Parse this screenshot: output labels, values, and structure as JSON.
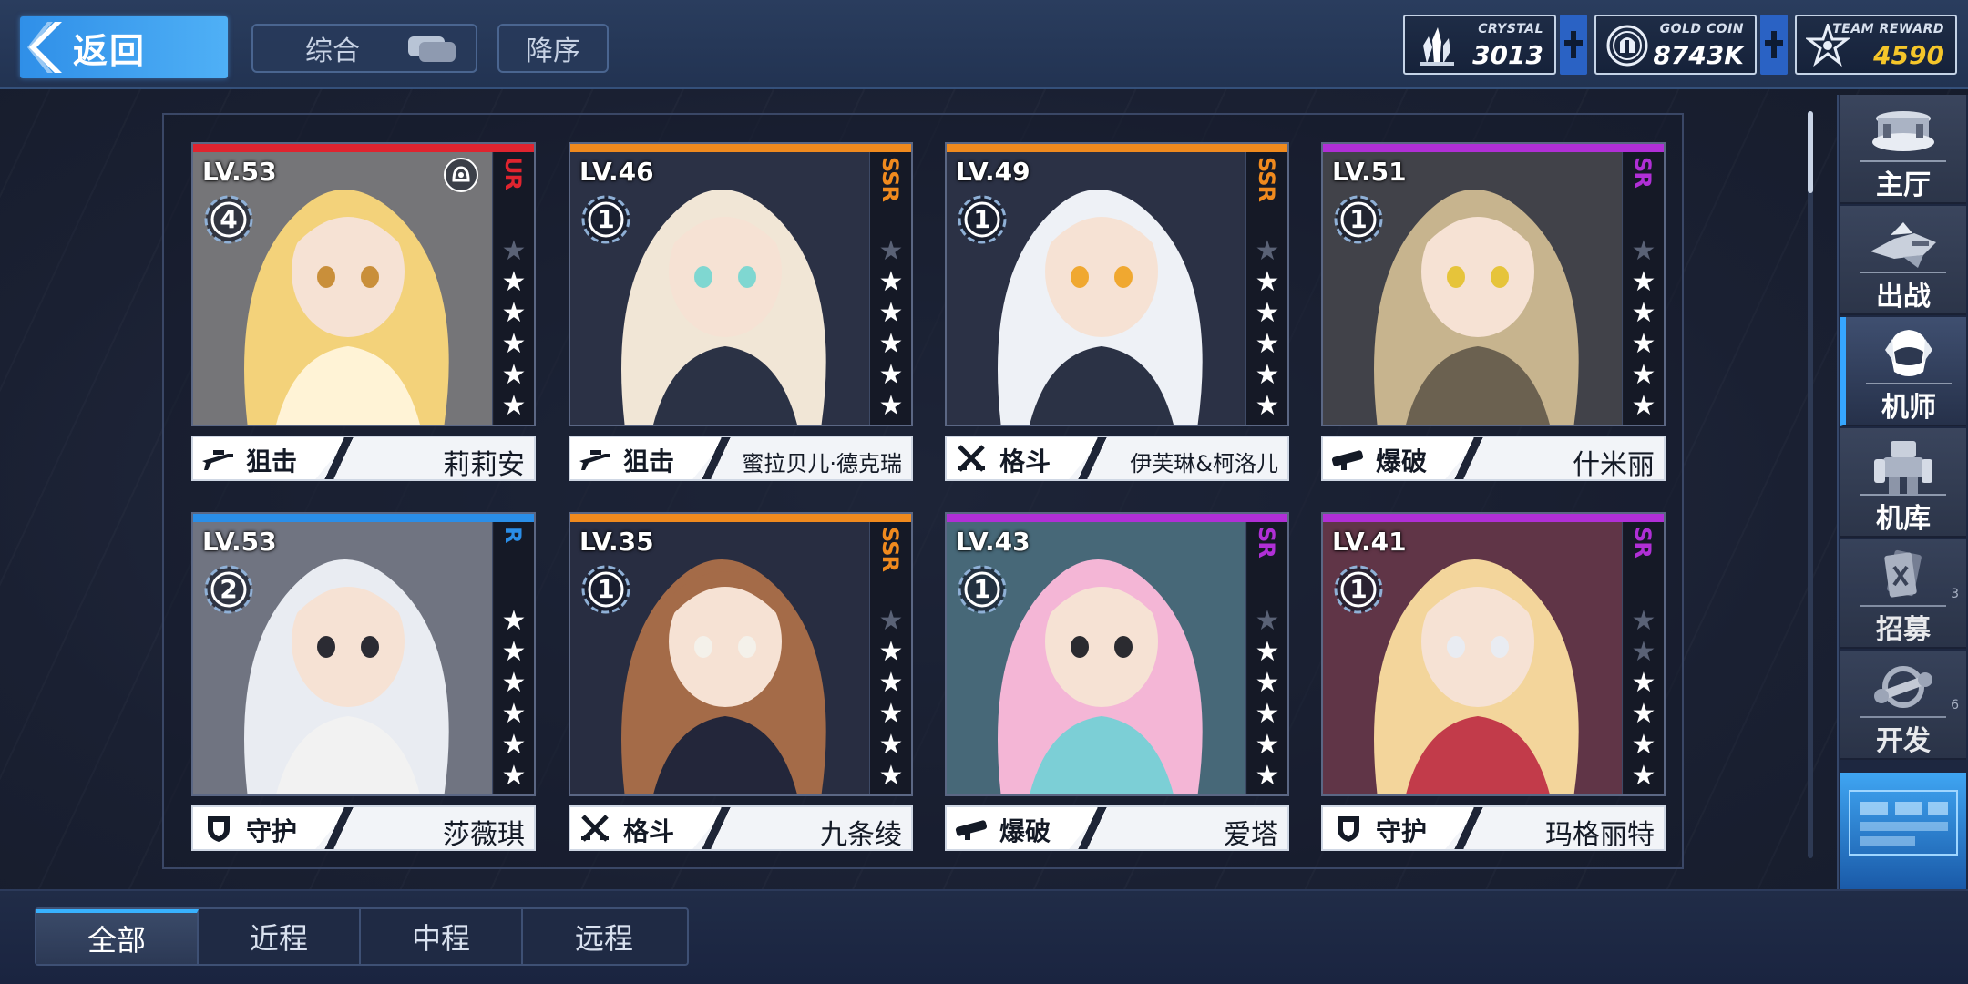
{
  "header": {
    "back_label": "返回",
    "sort_mode_label": "综合",
    "order_label": "降序"
  },
  "currencies": {
    "crystal": {
      "name": "CRYSTAL",
      "value": "3013",
      "icon": "crystal-icon"
    },
    "gold": {
      "name": "GOLD COIN",
      "value": "8743K",
      "icon": "gold-coin-icon"
    },
    "reward": {
      "name": "TEAM REWARD",
      "value": "4590",
      "icon": "team-reward-icon"
    }
  },
  "pilots": [
    {
      "level": "LV.53",
      "rank": "4",
      "rarity": "UR",
      "rarity_color": "#e0242f",
      "stars": 5,
      "max_stars": 6,
      "class": "狙击",
      "class_icon": "sniper-rifle-icon",
      "name": "莉莉安"
    },
    {
      "level": "LV.46",
      "rank": "1",
      "rarity": "SSR",
      "rarity_color": "#f08a1e",
      "stars": 5,
      "max_stars": 6,
      "class": "狙击",
      "class_icon": "sniper-rifle-icon",
      "name": "蜜拉贝儿·德克瑞"
    },
    {
      "level": "LV.49",
      "rank": "1",
      "rarity": "SSR",
      "rarity_color": "#f08a1e",
      "stars": 5,
      "max_stars": 6,
      "class": "格斗",
      "class_icon": "crossed-swords-icon",
      "name": "伊芙琳&柯洛儿"
    },
    {
      "level": "LV.51",
      "rank": "1",
      "rarity": "SR",
      "rarity_color": "#b02fd6",
      "stars": 5,
      "max_stars": 6,
      "class": "爆破",
      "class_icon": "bazooka-icon",
      "name": "什米丽"
    },
    {
      "level": "LV.53",
      "rank": "2",
      "rarity": "R",
      "rarity_color": "#2a8ee8",
      "stars": 6,
      "max_stars": 6,
      "class": "守护",
      "class_icon": "shield-icon",
      "name": "莎薇琪"
    },
    {
      "level": "LV.35",
      "rank": "1",
      "rarity": "SSR",
      "rarity_color": "#f08a1e",
      "stars": 5,
      "max_stars": 6,
      "class": "格斗",
      "class_icon": "crossed-swords-icon",
      "name": "九条绫"
    },
    {
      "level": "LV.43",
      "rank": "1",
      "rarity": "SR",
      "rarity_color": "#b02fd6",
      "stars": 5,
      "max_stars": 6,
      "class": "爆破",
      "class_icon": "bazooka-icon",
      "name": "爱塔"
    },
    {
      "level": "LV.41",
      "rank": "1",
      "rarity": "SR",
      "rarity_color": "#b02fd6",
      "stars": 4,
      "max_stars": 6,
      "class": "守护",
      "class_icon": "shield-icon",
      "name": "玛格丽特"
    }
  ],
  "nav": [
    {
      "label": "主厅",
      "icon": "hall-icon"
    },
    {
      "label": "出战",
      "icon": "sortie-icon"
    },
    {
      "label": "机师",
      "icon": "pilot-icon",
      "active": true
    },
    {
      "label": "机库",
      "icon": "hangar-icon"
    },
    {
      "label": "招募",
      "icon": "recruit-card-icon",
      "sub": "3"
    },
    {
      "label": "开发",
      "icon": "wrench-icon",
      "sub": "6"
    }
  ],
  "tabs": [
    "全部",
    "近程",
    "中程",
    "远程"
  ],
  "active_tab": 0
}
